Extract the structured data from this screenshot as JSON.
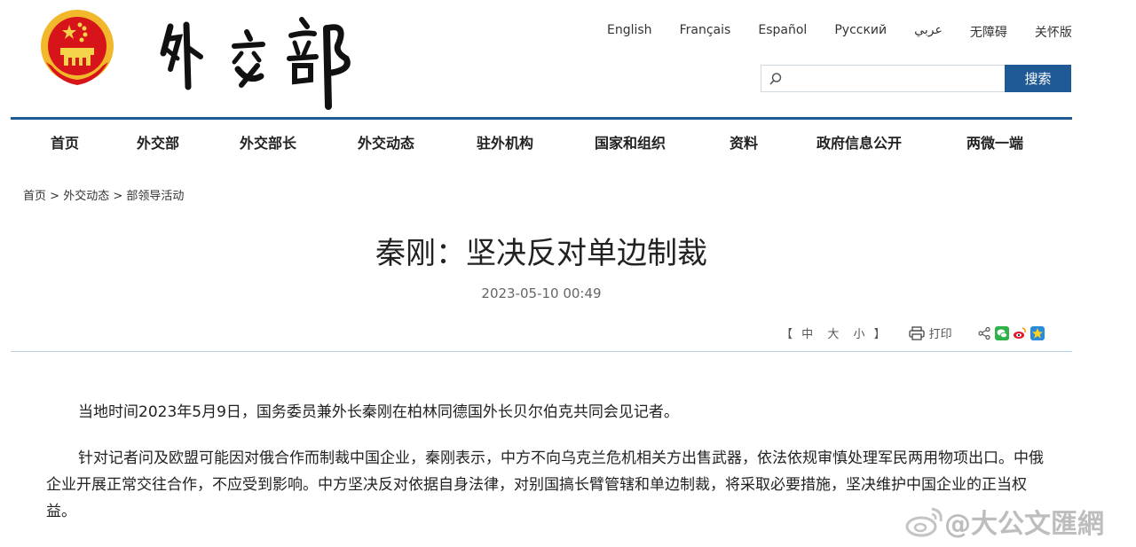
{
  "header": {
    "emblem_icon": "national-emblem-icon",
    "calligraphy": "外交部"
  },
  "languages": [
    "English",
    "Français",
    "Español",
    "Русский",
    "عربي",
    "无障碍",
    "关怀版"
  ],
  "search": {
    "placeholder": "",
    "button_label": "搜索"
  },
  "nav": [
    "首页",
    "外交部",
    "外交部长",
    "外交动态",
    "驻外机构",
    "国家和组织",
    "资料",
    "政府信息公开",
    "两微一端"
  ],
  "breadcrumb": {
    "items": [
      "首页",
      "外交动态",
      "部领导活动"
    ],
    "separator": ">"
  },
  "article": {
    "title": "秦刚：坚决反对单边制裁",
    "date": "2023-05-10 00:49",
    "paragraphs": [
      "当地时间2023年5月9日，国务委员兼外长秦刚在柏林同德国外长贝尔伯克共同会见记者。",
      "针对记者问及欧盟可能因对俄合作而制裁中国企业，秦刚表示，中方不向乌克兰危机相关方出售武器，依法依规审慎处理军民两用物项出口。中俄企业开展正常交往合作，不应受到影响。中方坚决反对依据自身法律，对别国搞长臂管辖和单边制裁，将采取必要措施，坚决维护中国企业的正当权益。"
    ]
  },
  "tools": {
    "bracket_open": "【",
    "sizes": [
      "中",
      "大",
      "小"
    ],
    "bracket_close": "】",
    "print_label": "打印",
    "share_icons": [
      "share-icon",
      "wechat-icon",
      "weibo-icon",
      "qzone-icon"
    ]
  },
  "watermark": {
    "text": "@大公文匯網",
    "icon": "weibo-icon"
  },
  "colors": {
    "brand_blue": "#1f5a96",
    "divider": "#b7d2e8",
    "emblem_red": "#d7141a",
    "emblem_gold": "#f4c430"
  }
}
